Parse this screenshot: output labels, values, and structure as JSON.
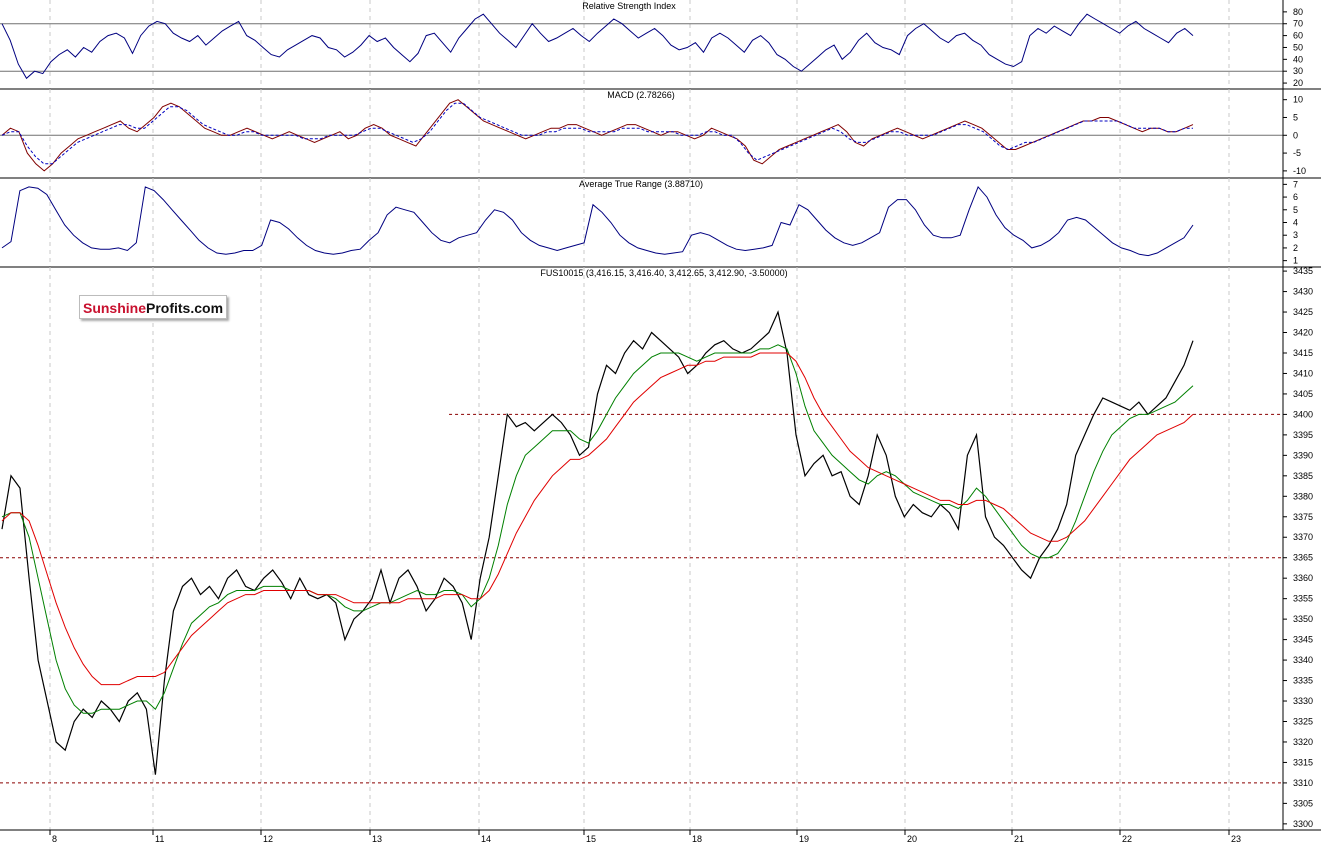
{
  "chart_data": [
    {
      "type": "line",
      "title": "Relative Strength Index",
      "ylim": [
        15,
        90
      ],
      "y_ticks": [
        20,
        30,
        40,
        50,
        60,
        70,
        80
      ],
      "reference_lines": [
        70,
        30
      ],
      "series": [
        {
          "color": "#000080",
          "values": [
            70,
            56,
            36,
            24,
            30,
            28,
            38,
            44,
            48,
            42,
            50,
            46,
            55,
            60,
            62,
            58,
            45,
            60,
            68,
            72,
            70,
            62,
            58,
            55,
            60,
            52,
            58,
            64,
            68,
            72,
            60,
            56,
            50,
            44,
            42,
            48,
            52,
            56,
            60,
            58,
            50,
            48,
            42,
            46,
            52,
            60,
            55,
            58,
            50,
            44,
            38,
            45,
            60,
            62,
            54,
            46,
            58,
            66,
            74,
            78,
            70,
            62,
            56,
            50,
            60,
            70,
            62,
            55,
            58,
            62,
            66,
            60,
            55,
            62,
            68,
            74,
            70,
            64,
            58,
            62,
            66,
            60,
            52,
            48,
            50,
            54,
            46,
            58,
            62,
            58,
            52,
            46,
            56,
            60,
            54,
            44,
            40,
            34,
            30,
            36,
            42,
            48,
            52,
            40,
            46,
            56,
            62,
            54,
            50,
            48,
            44,
            60,
            66,
            70,
            64,
            58,
            54,
            60,
            62,
            56,
            52,
            44,
            40,
            36,
            34,
            38,
            60,
            66,
            62,
            68,
            64,
            60,
            70,
            78,
            74,
            70,
            66,
            62,
            68,
            72,
            66,
            62,
            58,
            54,
            62,
            66,
            60
          ]
        }
      ],
      "xlabel": "",
      "ylabel": ""
    },
    {
      "type": "line",
      "title": "MACD (2.78266)",
      "ylim": [
        -12,
        13
      ],
      "y_ticks": [
        -10,
        -5,
        0,
        5,
        10
      ],
      "reference_lines": [
        0
      ],
      "series": [
        {
          "color": "#800000",
          "values": [
            0,
            2,
            1,
            -5,
            -8,
            -10,
            -8,
            -5,
            -3,
            -1,
            0,
            1,
            2,
            3,
            4,
            2,
            1,
            3,
            5,
            8,
            9,
            8,
            6,
            4,
            2,
            1,
            0,
            0,
            1,
            2,
            1,
            0,
            -1,
            0,
            1,
            0,
            -1,
            -2,
            -1,
            0,
            1,
            -1,
            0,
            2,
            3,
            2,
            0,
            -1,
            -2,
            -3,
            0,
            3,
            6,
            9,
            10,
            8,
            6,
            4,
            3,
            2,
            1,
            0,
            -1,
            0,
            1,
            2,
            2,
            3,
            3,
            2,
            1,
            0,
            1,
            2,
            3,
            3,
            2,
            1,
            0,
            1,
            1,
            0,
            -1,
            0,
            2,
            1,
            0,
            -1,
            -3,
            -7,
            -8,
            -6,
            -4,
            -3,
            -2,
            -1,
            0,
            1,
            2,
            3,
            1,
            -2,
            -3,
            -1,
            0,
            1,
            2,
            1,
            0,
            -1,
            0,
            1,
            2,
            3,
            4,
            3,
            2,
            0,
            -2,
            -4,
            -4,
            -3,
            -2,
            -1,
            0,
            1,
            2,
            3,
            4,
            4,
            5,
            5,
            4,
            3,
            2,
            1,
            2,
            2,
            1,
            1,
            2,
            3
          ]
        },
        {
          "color": "#0000c0",
          "values": [
            0,
            1,
            1,
            -3,
            -6,
            -8,
            -8,
            -6,
            -4,
            -2,
            -1,
            0,
            1,
            2,
            3,
            3,
            2,
            2,
            4,
            6,
            8,
            8,
            7,
            5,
            3,
            2,
            1,
            0,
            0,
            1,
            1,
            0,
            0,
            0,
            0,
            0,
            -1,
            -1,
            -1,
            0,
            0,
            0,
            0,
            1,
            2,
            2,
            1,
            0,
            -1,
            -2,
            -1,
            1,
            4,
            7,
            9,
            9,
            7,
            5,
            4,
            3,
            2,
            1,
            0,
            0,
            0,
            1,
            1,
            2,
            2,
            2,
            1,
            1,
            1,
            1,
            2,
            2,
            2,
            1,
            1,
            1,
            1,
            0,
            0,
            0,
            1,
            1,
            0,
            0,
            -2,
            -5,
            -7,
            -6,
            -5,
            -4,
            -3,
            -2,
            -1,
            0,
            1,
            2,
            1,
            -1,
            -2,
            -2,
            -1,
            0,
            1,
            1,
            0,
            0,
            0,
            0,
            1,
            2,
            3,
            3,
            2,
            1,
            -1,
            -3,
            -4,
            -3,
            -2,
            -2,
            -1,
            0,
            1,
            2,
            3,
            4,
            4,
            4,
            4,
            4,
            3,
            2,
            2,
            2,
            2,
            1,
            1,
            2,
            2
          ]
        }
      ],
      "xlabel": "",
      "ylabel": ""
    },
    {
      "type": "line",
      "title": "Average True Range (3.88710)",
      "ylim": [
        0.5,
        7.5
      ],
      "y_ticks": [
        1,
        2,
        3,
        4,
        5,
        6,
        7
      ],
      "series": [
        {
          "color": "#000080",
          "values": [
            2.0,
            2.5,
            6.5,
            6.8,
            6.7,
            6.2,
            5.0,
            3.8,
            3.0,
            2.4,
            2.0,
            1.9,
            1.9,
            2.0,
            1.8,
            2.4,
            6.8,
            6.5,
            5.8,
            5.0,
            4.2,
            3.4,
            2.6,
            2.0,
            1.6,
            1.5,
            1.6,
            1.8,
            1.8,
            2.2,
            4.2,
            4.0,
            3.5,
            2.8,
            2.2,
            1.8,
            1.6,
            1.5,
            1.6,
            1.8,
            1.9,
            2.6,
            3.2,
            4.6,
            5.2,
            5.0,
            4.8,
            4.0,
            3.2,
            2.6,
            2.4,
            2.8,
            3.0,
            3.2,
            4.2,
            5.0,
            4.8,
            4.2,
            3.2,
            2.6,
            2.2,
            2.0,
            1.8,
            2.0,
            2.2,
            2.4,
            5.4,
            4.8,
            4.0,
            3.0,
            2.4,
            2.0,
            1.8,
            1.6,
            1.5,
            1.6,
            1.7,
            3.0,
            3.2,
            3.0,
            2.6,
            2.2,
            1.9,
            1.8,
            1.9,
            2.0,
            2.2,
            4.0,
            3.8,
            5.4,
            5.0,
            4.2,
            3.4,
            2.8,
            2.4,
            2.2,
            2.4,
            2.8,
            3.2,
            5.2,
            5.8,
            5.8,
            5.0,
            3.8,
            3.0,
            2.8,
            2.8,
            3.0,
            5.0,
            6.8,
            6.0,
            4.6,
            3.6,
            3.0,
            2.6,
            2.0,
            2.2,
            2.6,
            3.2,
            4.2,
            4.4,
            4.2,
            3.6,
            3.0,
            2.4,
            2.0,
            1.8,
            1.5,
            1.4,
            1.6,
            2.0,
            2.4,
            2.8,
            3.8
          ]
        }
      ],
      "xlabel": "",
      "ylabel": ""
    },
    {
      "type": "line",
      "title": "FUS10015 (3,416.15, 3,416.40, 3,412.65, 3,412.90, -3.50000)",
      "ylim": [
        3298.5,
        3436
      ],
      "y_ticks": [
        3300,
        3305,
        3310,
        3315,
        3320,
        3325,
        3330,
        3335,
        3340,
        3345,
        3350,
        3355,
        3360,
        3365,
        3370,
        3375,
        3380,
        3385,
        3390,
        3395,
        3400,
        3405,
        3410,
        3415,
        3420,
        3425,
        3430,
        3435
      ],
      "x_ticks": [
        "8",
        "11",
        "12",
        "13",
        "14",
        "15",
        "18",
        "19",
        "20",
        "21",
        "22",
        "23"
      ],
      "reference_lines": [
        {
          "y": 3400,
          "color": "#8b0000",
          "x_start_fraction": 0.35
        },
        {
          "y": 3365,
          "color": "#8b0000",
          "x_start_fraction": 0
        },
        {
          "y": 3310,
          "color": "#8b0000",
          "x_start_fraction": 0
        }
      ],
      "series": [
        {
          "color": "#000000",
          "values": [
            3372,
            3385,
            3382,
            3360,
            3340,
            3330,
            3320,
            3318,
            3325,
            3328,
            3326,
            3330,
            3328,
            3325,
            3330,
            3332,
            3328,
            3312,
            3335,
            3352,
            3358,
            3360,
            3356,
            3358,
            3355,
            3360,
            3362,
            3358,
            3357,
            3360,
            3362,
            3359,
            3355,
            3360,
            3356,
            3355,
            3356,
            3354,
            3345,
            3350,
            3352,
            3355,
            3362,
            3354,
            3360,
            3362,
            3358,
            3352,
            3355,
            3360,
            3358,
            3354,
            3345,
            3360,
            3370,
            3385,
            3400,
            3397,
            3398,
            3396,
            3398,
            3400,
            3398,
            3395,
            3390,
            3392,
            3405,
            3412,
            3410,
            3415,
            3418,
            3416,
            3420,
            3418,
            3416,
            3414,
            3410,
            3412,
            3415,
            3417,
            3418,
            3416,
            3415,
            3416,
            3418,
            3420,
            3425,
            3415,
            3395,
            3385,
            3388,
            3390,
            3385,
            3386,
            3380,
            3378,
            3385,
            3395,
            3390,
            3380,
            3375,
            3378,
            3376,
            3375,
            3378,
            3376,
            3372,
            3390,
            3395,
            3375,
            3370,
            3368,
            3365,
            3362,
            3360,
            3365,
            3368,
            3372,
            3378,
            3390,
            3395,
            3400,
            3404,
            3403,
            3402,
            3401,
            3403,
            3400,
            3402,
            3404,
            3408,
            3412,
            3418
          ]
        },
        {
          "color": "#008000",
          "values": [
            3375,
            3376,
            3376,
            3370,
            3360,
            3350,
            3340,
            3333,
            3329,
            3327,
            3327,
            3328,
            3328,
            3328,
            3329,
            3330,
            3330,
            3328,
            3332,
            3338,
            3344,
            3349,
            3351,
            3353,
            3354,
            3356,
            3357,
            3357,
            3357,
            3358,
            3358,
            3358,
            3357,
            3357,
            3357,
            3356,
            3356,
            3355,
            3353,
            3352,
            3352,
            3353,
            3354,
            3354,
            3355,
            3356,
            3357,
            3356,
            3356,
            3357,
            3357,
            3356,
            3353,
            3355,
            3360,
            3368,
            3378,
            3385,
            3390,
            3392,
            3394,
            3396,
            3396,
            3396,
            3394,
            3393,
            3396,
            3400,
            3404,
            3407,
            3410,
            3412,
            3414,
            3415,
            3415,
            3415,
            3414,
            3413,
            3414,
            3415,
            3415,
            3415,
            3415,
            3415,
            3416,
            3416,
            3417,
            3416,
            3410,
            3402,
            3396,
            3393,
            3390,
            3388,
            3386,
            3384,
            3383,
            3385,
            3386,
            3385,
            3383,
            3381,
            3380,
            3379,
            3378,
            3378,
            3377,
            3379,
            3382,
            3380,
            3377,
            3374,
            3371,
            3368,
            3366,
            3365,
            3365,
            3366,
            3369,
            3374,
            3380,
            3386,
            3391,
            3395,
            3397,
            3399,
            3400,
            3400,
            3401,
            3402,
            3403,
            3405,
            3407
          ]
        },
        {
          "color": "#e00000",
          "values": [
            3374,
            3376,
            3376,
            3374,
            3368,
            3361,
            3354,
            3348,
            3343,
            3339,
            3336,
            3334,
            3334,
            3334,
            3335,
            3336,
            3336,
            3336,
            3337,
            3340,
            3343,
            3346,
            3348,
            3350,
            3352,
            3354,
            3355,
            3356,
            3356,
            3357,
            3357,
            3357,
            3357,
            3357,
            3357,
            3356,
            3356,
            3356,
            3355,
            3354,
            3354,
            3354,
            3354,
            3354,
            3354,
            3355,
            3355,
            3355,
            3355,
            3356,
            3356,
            3356,
            3355,
            3355,
            3357,
            3361,
            3366,
            3371,
            3375,
            3379,
            3382,
            3385,
            3387,
            3389,
            3389,
            3390,
            3392,
            3394,
            3397,
            3400,
            3403,
            3405,
            3407,
            3409,
            3410,
            3411,
            3412,
            3412,
            3413,
            3413,
            3414,
            3414,
            3414,
            3414,
            3415,
            3415,
            3415,
            3415,
            3413,
            3409,
            3404,
            3400,
            3397,
            3394,
            3391,
            3389,
            3387,
            3386,
            3385,
            3384,
            3383,
            3382,
            3381,
            3380,
            3379,
            3379,
            3378,
            3378,
            3379,
            3379,
            3378,
            3377,
            3375,
            3373,
            3371,
            3370,
            3369,
            3369,
            3370,
            3372,
            3374,
            3377,
            3380,
            3383,
            3386,
            3389,
            3391,
            3393,
            3395,
            3396,
            3397,
            3398,
            3400
          ]
        }
      ],
      "xlabel": "",
      "ylabel": ""
    }
  ],
  "logo": {
    "part1": "Sunshine",
    "part2": "Profits.com"
  }
}
